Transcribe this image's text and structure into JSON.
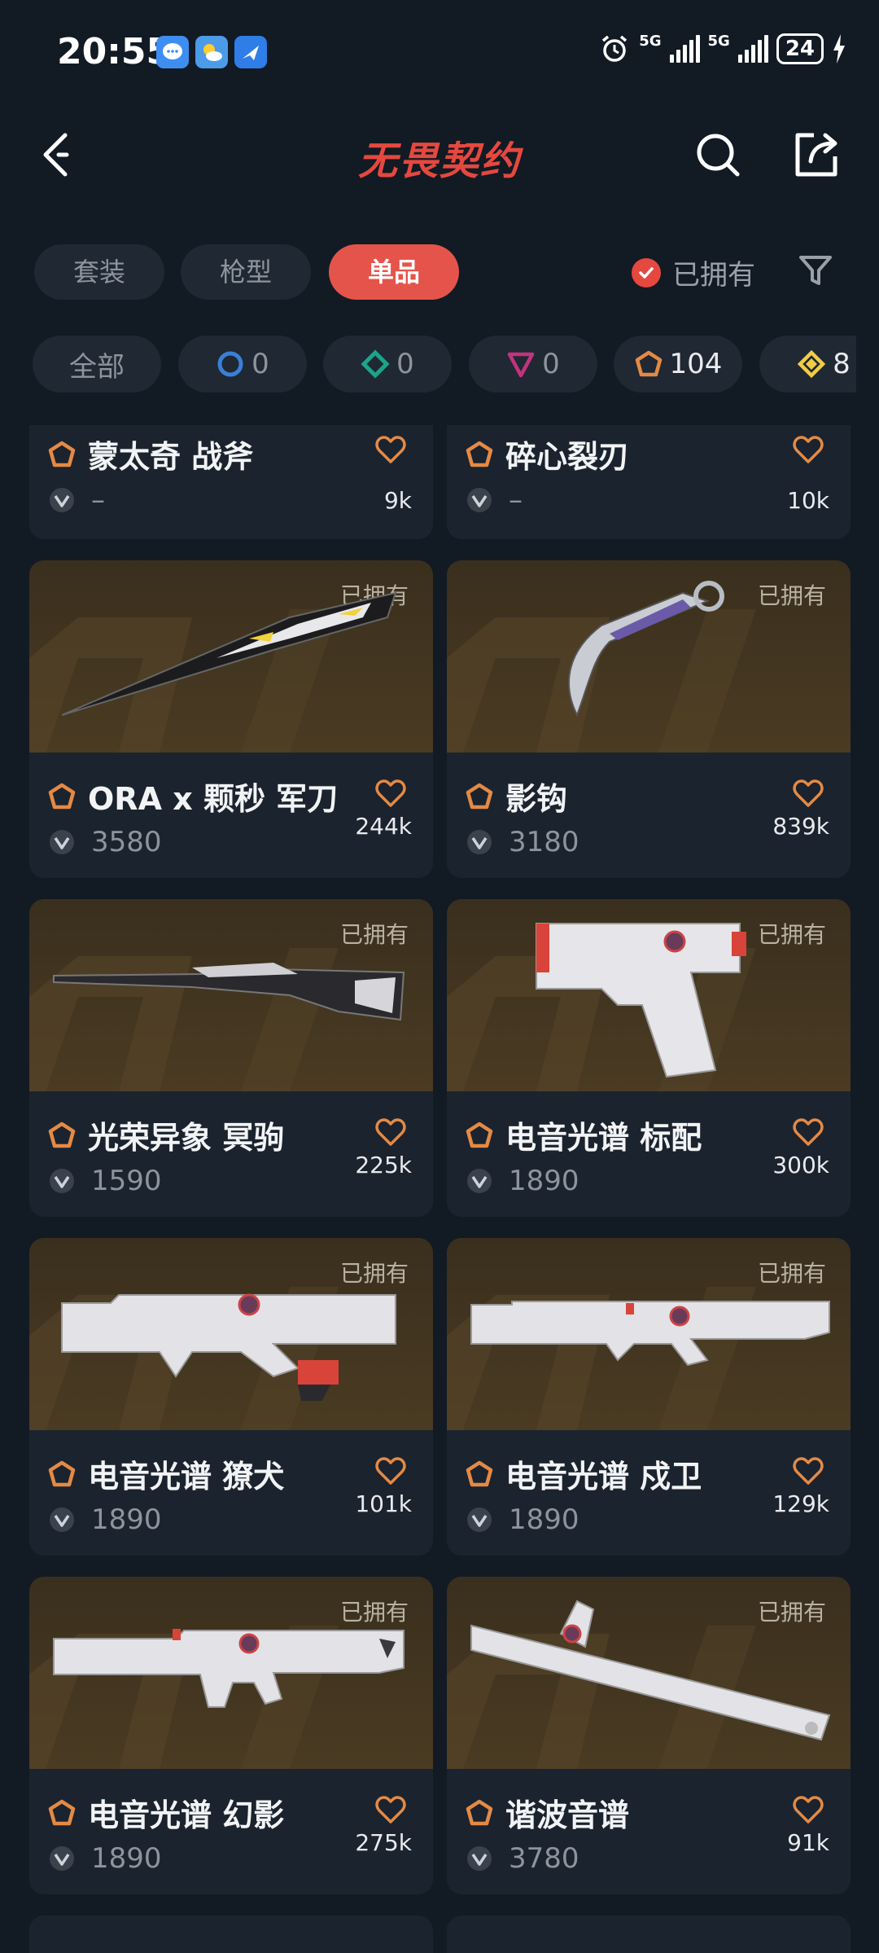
{
  "status_bar": {
    "time": "20:55",
    "net1": "5G",
    "net2": "5G",
    "battery": "24"
  },
  "header": {
    "title": "无畏契约"
  },
  "tabs": [
    {
      "label": "套装",
      "active": false
    },
    {
      "label": "枪型",
      "active": false
    },
    {
      "label": "单品",
      "active": true
    }
  ],
  "owned_toggle": {
    "label": "已拥有",
    "checked": true
  },
  "chips": [
    {
      "label": "全部",
      "icon": "all",
      "color": ""
    },
    {
      "label": "0",
      "icon": "select-tier-icon",
      "color": "#3b7fd6"
    },
    {
      "label": "0",
      "icon": "deluxe-tier-icon",
      "color": "#1aa58a"
    },
    {
      "label": "0",
      "icon": "premium-tier-icon",
      "color": "#c2337e"
    },
    {
      "label": "104",
      "icon": "exclusive-tier-icon",
      "color": "#e48a45"
    },
    {
      "label": "8",
      "icon": "ultra-tier-icon",
      "color": "#f2cc46"
    }
  ],
  "owned_label": "已拥有",
  "items": [
    {
      "name": "蒙太奇 战斧",
      "price": "–",
      "likes": "9k"
    },
    {
      "name": "碎心裂刃",
      "price": "–",
      "likes": "10k"
    },
    {
      "name": "ORA x 颗秒 军刀",
      "price": "3580",
      "likes": "244k",
      "weapon": "blade"
    },
    {
      "name": "影钩",
      "price": "3180",
      "likes": "839k",
      "weapon": "karambit"
    },
    {
      "name": "光荣异象 冥驹",
      "price": "1590",
      "likes": "225k",
      "weapon": "sniper"
    },
    {
      "name": "电音光谱 标配",
      "price": "1890",
      "likes": "300k",
      "weapon": "pistol"
    },
    {
      "name": "电音光谱 獠犬",
      "price": "1890",
      "likes": "101k",
      "weapon": "rifle"
    },
    {
      "name": "电音光谱 戍卫",
      "price": "1890",
      "likes": "129k",
      "weapon": "guardian"
    },
    {
      "name": "电音光谱 幻影",
      "price": "1890",
      "likes": "275k",
      "weapon": "phantom"
    },
    {
      "name": "谐波音谱",
      "price": "3780",
      "likes": "91k",
      "weapon": "melee"
    }
  ]
}
